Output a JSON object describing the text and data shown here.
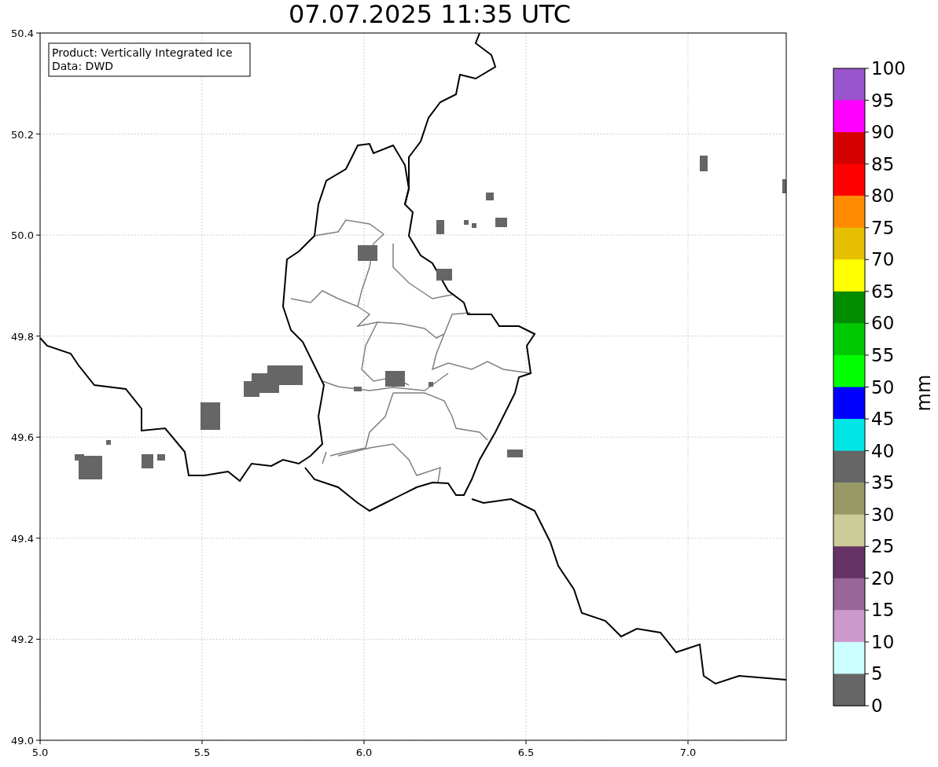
{
  "title": "07.07.2025 11:35 UTC",
  "info_box": {
    "lines": [
      "Product: Vertically Integrated Ice",
      "Data: DWD"
    ]
  },
  "x_ticks": [
    "5.0",
    "5.5",
    "6.0",
    "6.5",
    "7.0"
  ],
  "y_ticks": [
    "50.4",
    "50.2",
    "50.0",
    "49.8",
    "49.6",
    "49.4",
    "49.2",
    "49.0"
  ],
  "colorbar": {
    "label": "mm",
    "segments": [
      {
        "color": "#9955cc"
      },
      {
        "color": "#ff00ff"
      },
      {
        "color": "#d40000"
      },
      {
        "color": "#ff0000"
      },
      {
        "color": "#ff8c00"
      },
      {
        "color": "#e5bf00"
      },
      {
        "color": "#ffff00"
      },
      {
        "color": "#008c00"
      },
      {
        "color": "#00c800"
      },
      {
        "color": "#00ff00"
      },
      {
        "color": "#0000ff"
      },
      {
        "color": "#00e5e5"
      },
      {
        "color": "#666666"
      },
      {
        "color": "#999966"
      },
      {
        "color": "#cccc99"
      },
      {
        "color": "#663366"
      },
      {
        "color": "#996699"
      },
      {
        "color": "#cc99cc"
      },
      {
        "color": "#ccffff"
      },
      {
        "color": "#666666"
      }
    ],
    "ticks": [
      "100",
      "95",
      "90",
      "85",
      "80",
      "75",
      "70",
      "65",
      "60",
      "55",
      "50",
      "45",
      "40",
      "35",
      "30",
      "25",
      "20",
      "15",
      "10",
      "5",
      "0"
    ]
  }
}
